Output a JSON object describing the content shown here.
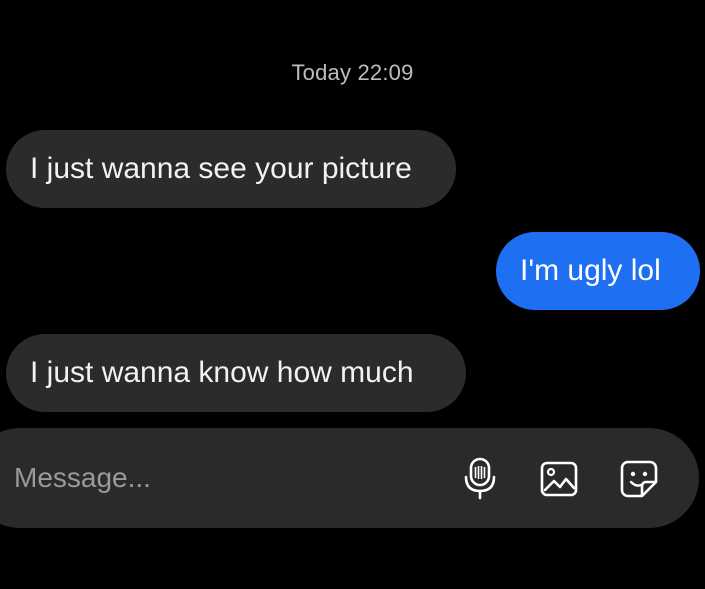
{
  "conversation": {
    "timestamp": "Today 22:09",
    "messages": [
      {
        "direction": "incoming",
        "text": "I just wanna see your picture"
      },
      {
        "direction": "outgoing",
        "text": "I'm ugly lol"
      },
      {
        "direction": "incoming",
        "text": "I just wanna know how much"
      }
    ]
  },
  "composer": {
    "placeholder": "Message...",
    "value": "",
    "icons": [
      "microphone-icon",
      "gallery-icon",
      "sticker-icon"
    ]
  },
  "colors": {
    "background": "#000000",
    "incoming_bubble": "#2b2b2b",
    "outgoing_bubble": "#1f6ff2",
    "composer": "#2a2a2a",
    "timestamp_text": "#bdbdbd",
    "placeholder_text": "#9a9a9a"
  }
}
